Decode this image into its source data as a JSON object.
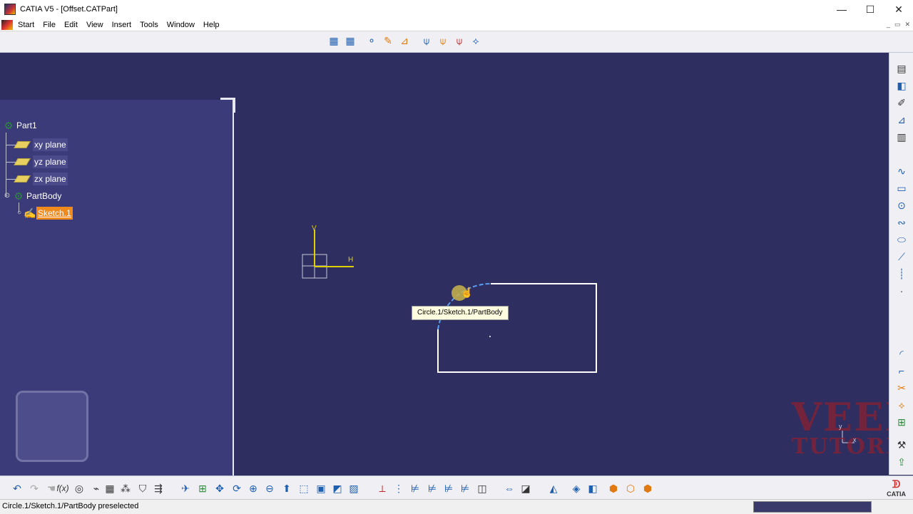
{
  "window": {
    "title": "CATIA V5 - [Offset.CATPart]",
    "controls": [
      "—",
      "☐",
      "✕"
    ]
  },
  "menu": {
    "items": [
      "Start",
      "File",
      "Edit",
      "View",
      "Insert",
      "Tools",
      "Window",
      "Help"
    ],
    "mdi_controls": [
      "_",
      "▭",
      "✕"
    ]
  },
  "tree": {
    "root": "Part1",
    "items": [
      {
        "label": "xy plane"
      },
      {
        "label": "yz plane"
      },
      {
        "label": "zx plane"
      },
      {
        "label": "PartBody"
      },
      {
        "label": "Sketch.1"
      }
    ]
  },
  "canvas": {
    "axis_h_label": "H",
    "axis_v_label": "V",
    "tooltip": "Circle.1/Sketch.1/PartBody",
    "mini_axis_x": "x",
    "mini_axis_y": "y"
  },
  "watermark": {
    "line1": "VEER",
    "line2": "TUTORIAL"
  },
  "status": {
    "text": "Circle.1/Sketch.1/PartBody preselected"
  },
  "brand": {
    "logo_text": "CATIA"
  }
}
